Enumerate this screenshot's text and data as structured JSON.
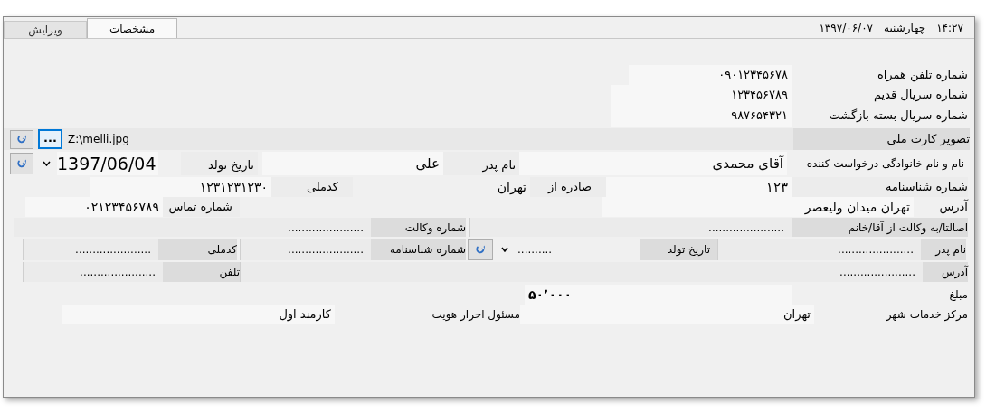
{
  "tabs": [
    {
      "label": "مشخصات",
      "selected": true
    },
    {
      "label": "ویرایش",
      "selected": false
    }
  ],
  "header": {
    "weekday": "چهارشنبه",
    "date": "۱۳۹۷/۰۶/۰۷",
    "time": "۱۴:۲۷"
  },
  "form": {
    "mobile_label": "شماره تلفن همراه",
    "mobile": "۰۹۰۱۲۳۴۵۶۷۸",
    "old_serial_label": "شماره سریال قدیم",
    "old_serial": "۱۲۳۴۵۶۷۸۹",
    "return_serial_label": "شماره سریال بسته بازگشت",
    "return_serial": "۹۸۷۶۵۴۳۲۱",
    "card_image_label": "تصویر کارت ملی",
    "browse_button": "...",
    "card_image_path": "Z:\\melli.jpg",
    "birth_date": "1397/06/04",
    "birth_date_label": "تاریخ تولد",
    "father": "علی",
    "father_label": "نام پدر",
    "applicant": "آقای محمدی",
    "applicant_label": "نام و نام خانوادگی درخواست کننده",
    "national_code": "۱۲۳۱۲۳۱۲۳۰",
    "national_code_label": "کدملی",
    "issued_at": "تهران",
    "issued_at_label": "صادره از",
    "id_number": "۱۲۳",
    "id_number_label": "شماره شناسنامه",
    "contact": "۰۲۱۲۳۴۵۶۷۸۹",
    "contact_label": "شماره تماس",
    "address": "تهران میدان ولیعصر",
    "address_label": "آدرس",
    "power_no": "......................",
    "power_no_label": "شماره وکالت",
    "on_behalf": "......................",
    "on_behalf_label": "اصالتا/به وکالت از آقا/خانم",
    "rep_national": "......................",
    "rep_national_label": "کدملی",
    "rep_id": "......................",
    "rep_id_label": "شماره شناسنامه",
    "rep_birth": "..........",
    "rep_birth_label": "تاریخ تولد",
    "rep_father": "......................",
    "rep_father_label": "نام پدر",
    "rep_phone": "......................",
    "rep_phone_label": "تلفن",
    "rep_address": "......................",
    "rep_address_label": "آدرس",
    "amount": "۵۰٬۰۰۰",
    "amount_label": "مبلغ",
    "verifier": "کارمند اول",
    "verifier_label": "مسئول احراز هویت",
    "center": "تهران",
    "center_label": "مرکز خدمات شهر"
  }
}
